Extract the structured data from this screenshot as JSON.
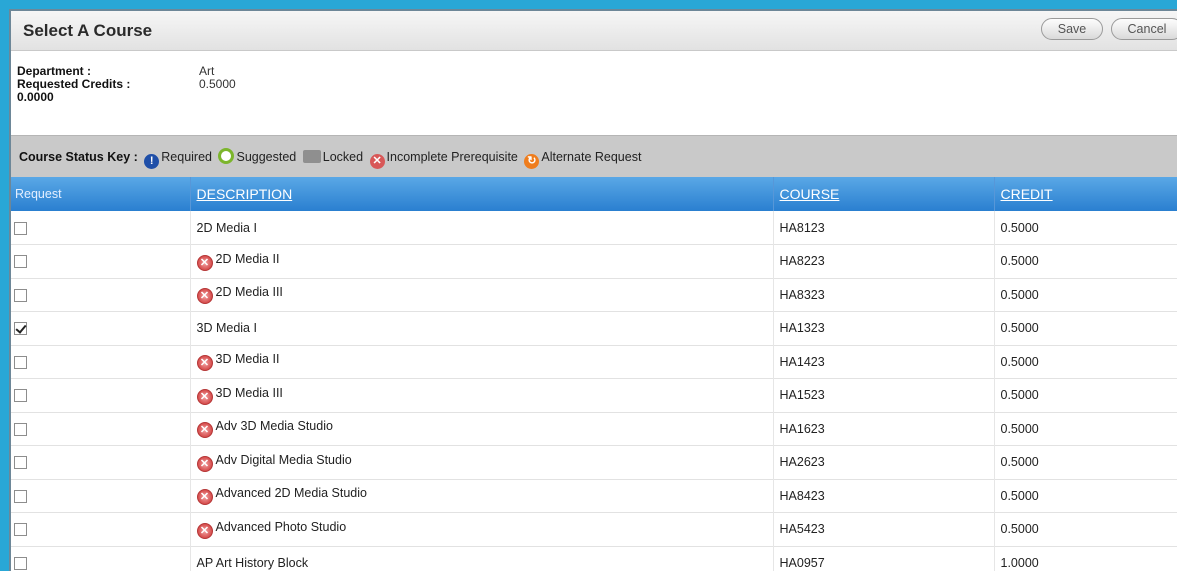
{
  "header": {
    "title": "Select A Course",
    "save_label": "Save",
    "cancel_label": "Cancel"
  },
  "info": {
    "department_label": "Department :",
    "department_value": "Art",
    "credits_label": "Requested Credits :",
    "credits_value": "0.5000",
    "credits_extra": "0.0000"
  },
  "status_key": {
    "label": "Course Status Key :",
    "items": [
      {
        "icon": "required-icon",
        "text": "Required",
        "color": "#1f4fa8"
      },
      {
        "icon": "suggested-icon",
        "text": "Suggested",
        "color": "#7cb52c"
      },
      {
        "icon": "locked-icon",
        "text": "Locked",
        "color": "#8f8f8f"
      },
      {
        "icon": "incomplete-prerequisite-icon",
        "text": "Incomplete Prerequisite",
        "color": "#d85858"
      },
      {
        "icon": "alternate-request-icon",
        "text": "Alternate Request",
        "color": "#ef7d1d"
      }
    ]
  },
  "table": {
    "columns": [
      "Request",
      "DESCRIPTION",
      "COURSE",
      "CREDIT"
    ],
    "rows": [
      {
        "checked": false,
        "prereq_warning": false,
        "description": "2D Media I",
        "course": "HA8123",
        "credit": "0.5000"
      },
      {
        "checked": false,
        "prereq_warning": true,
        "description": "2D Media II",
        "course": "HA8223",
        "credit": "0.5000"
      },
      {
        "checked": false,
        "prereq_warning": true,
        "description": "2D Media III",
        "course": "HA8323",
        "credit": "0.5000"
      },
      {
        "checked": true,
        "prereq_warning": false,
        "description": "3D Media I",
        "course": "HA1323",
        "credit": "0.5000"
      },
      {
        "checked": false,
        "prereq_warning": true,
        "description": "3D Media II",
        "course": "HA1423",
        "credit": "0.5000"
      },
      {
        "checked": false,
        "prereq_warning": true,
        "description": "3D Media III",
        "course": "HA1523",
        "credit": "0.5000"
      },
      {
        "checked": false,
        "prereq_warning": true,
        "description": "Adv 3D Media Studio",
        "course": "HA1623",
        "credit": "0.5000"
      },
      {
        "checked": false,
        "prereq_warning": true,
        "description": "Adv Digital Media Studio",
        "course": "HA2623",
        "credit": "0.5000"
      },
      {
        "checked": false,
        "prereq_warning": true,
        "description": "Advanced 2D Media Studio",
        "course": "HA8423",
        "credit": "0.5000"
      },
      {
        "checked": false,
        "prereq_warning": true,
        "description": "Advanced Photo Studio",
        "course": "HA5423",
        "credit": "0.5000"
      },
      {
        "checked": false,
        "prereq_warning": false,
        "description": "AP Art History Block",
        "course": "HA0957",
        "credit": "1.0000"
      }
    ]
  }
}
